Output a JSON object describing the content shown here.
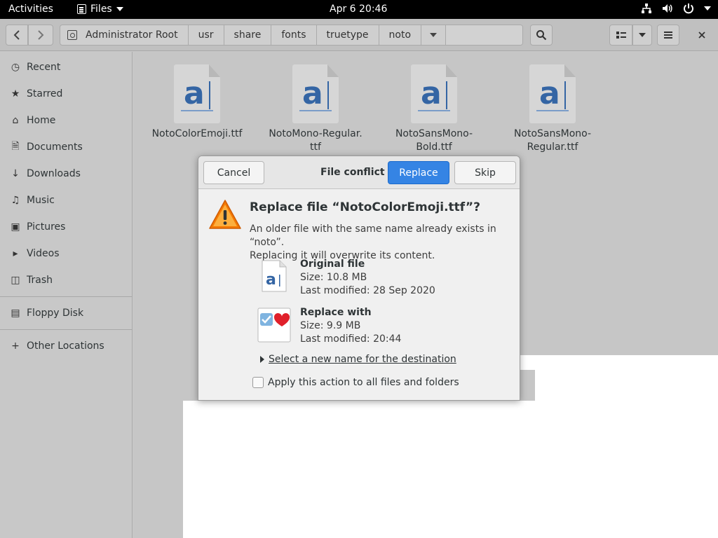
{
  "topbar": {
    "activities": "Activities",
    "app_name": "Files",
    "clock": "Apr 6  20:46"
  },
  "pathbar": {
    "crumbs": [
      "Administrator Root",
      "usr",
      "share",
      "fonts",
      "truetype",
      "noto"
    ]
  },
  "sidebar": {
    "items": [
      {
        "label": "Recent",
        "icon": "clock-icon"
      },
      {
        "label": "Starred",
        "icon": "star-icon"
      },
      {
        "label": "Home",
        "icon": "home-icon"
      },
      {
        "label": "Documents",
        "icon": "document-icon"
      },
      {
        "label": "Downloads",
        "icon": "download-icon"
      },
      {
        "label": "Music",
        "icon": "music-icon"
      },
      {
        "label": "Pictures",
        "icon": "camera-icon"
      },
      {
        "label": "Videos",
        "icon": "video-icon"
      },
      {
        "label": "Trash",
        "icon": "trash-icon"
      },
      {
        "label": "Floppy Disk",
        "icon": "disk-icon"
      },
      {
        "label": "Other Locations",
        "icon": "plus-icon"
      }
    ]
  },
  "files": [
    {
      "name_line1": "NotoColorEmoji.ttf",
      "name_line2": ""
    },
    {
      "name_line1": "NotoMono-Regular.",
      "name_line2": "ttf"
    },
    {
      "name_line1": "NotoSansMono-",
      "name_line2": "Bold.ttf"
    },
    {
      "name_line1": "NotoSansMono-",
      "name_line2": "Regular.ttf"
    }
  ],
  "dialog": {
    "title": "File conflict",
    "cancel_label": "Cancel",
    "replace_label": "Replace",
    "skip_label": "Skip",
    "primary_text": "Replace file “NotoColorEmoji.ttf”?",
    "secondary_line1": "An older file with the same name already exists in “noto”.",
    "secondary_line2": "Replacing it will overwrite its content.",
    "original": {
      "heading": "Original file",
      "size": "Size: 10.8 MB",
      "modified": "Last modified: 28 Sep 2020"
    },
    "replacement": {
      "heading": "Replace with",
      "size": "Size: 9.9 MB",
      "modified": "Last modified: 20:44"
    },
    "expander_label": "Select a new name for the destination",
    "checkbox_label": "Apply this action to all files and folders"
  },
  "colors": {
    "accent": "#3584e4",
    "font_glyph": "#3465a4",
    "warning": "#f57900"
  }
}
